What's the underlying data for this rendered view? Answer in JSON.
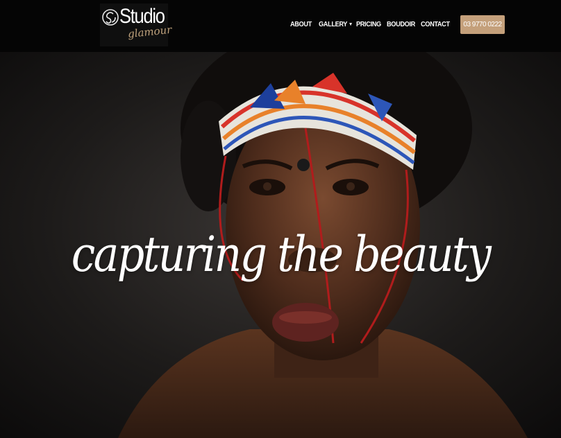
{
  "brand": {
    "logo_top": "Studio",
    "logo_bottom": "glamour",
    "accent_color": "#c4a07b"
  },
  "nav": {
    "items": [
      {
        "label": "ABOUT",
        "has_dropdown": false
      },
      {
        "label": "GALLERY",
        "has_dropdown": true
      },
      {
        "label": "PRICING",
        "has_dropdown": false
      },
      {
        "label": "BOUDOIR",
        "has_dropdown": false
      },
      {
        "label": "CONTACT",
        "has_dropdown": false
      }
    ],
    "phone": "03 9770 0222",
    "dropdown_icon": "chevron-down-icon"
  },
  "hero": {
    "tagline": "capturing the beauty"
  }
}
